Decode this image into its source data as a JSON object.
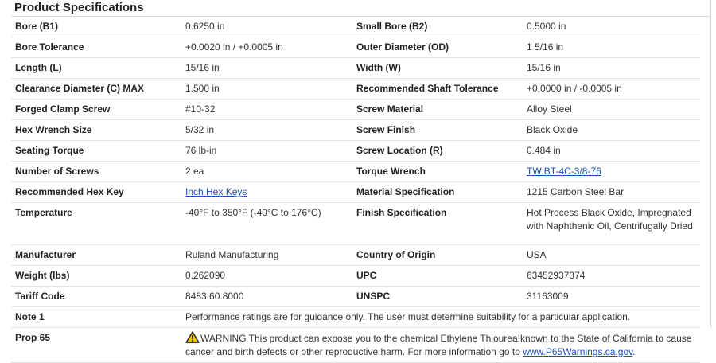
{
  "section_title": "Product Specifications",
  "specs": {
    "bore_b1": {
      "label": "Bore (B1)",
      "value": "0.6250 in"
    },
    "small_bore_b2": {
      "label": "Small Bore (B2)",
      "value": "0.5000 in"
    },
    "bore_tolerance": {
      "label": "Bore Tolerance",
      "value": "+0.0020 in / +0.0005 in"
    },
    "outer_diameter": {
      "label": "Outer Diameter (OD)",
      "value": "1 5/16 in"
    },
    "length": {
      "label": "Length (L)",
      "value": "15/16 in"
    },
    "width": {
      "label": "Width (W)",
      "value": "15/16 in"
    },
    "clearance_diameter": {
      "label": "Clearance Diameter (C) MAX",
      "value": "1.500 in"
    },
    "shaft_tolerance": {
      "label": "Recommended Shaft Tolerance",
      "value": "+0.0000 in / -0.0005 in"
    },
    "clamp_screw": {
      "label": "Forged Clamp Screw",
      "value": "#10-32"
    },
    "screw_material": {
      "label": "Screw Material",
      "value": "Alloy Steel"
    },
    "hex_wrench": {
      "label": "Hex Wrench Size",
      "value": "5/32 in"
    },
    "screw_finish": {
      "label": "Screw Finish",
      "value": "Black Oxide"
    },
    "seating_torque": {
      "label": "Seating Torque",
      "value": "76 lb-in"
    },
    "screw_location": {
      "label": "Screw Location (R)",
      "value": "0.484 in"
    },
    "num_screws": {
      "label": "Number of Screws",
      "value": "2 ea"
    },
    "torque_wrench": {
      "label": "Torque Wrench",
      "value": "TW:BT-4C-3/8-76"
    },
    "hex_key": {
      "label": "Recommended Hex Key",
      "value": "Inch Hex Keys"
    },
    "material_spec": {
      "label": "Material Specification",
      "value": "1215 Carbon Steel Bar"
    },
    "temperature": {
      "label": "Temperature",
      "value": "-40°F to 350°F (-40°C to 176°C)"
    },
    "finish_spec": {
      "label": "Finish Specification",
      "value": "Hot Process Black Oxide, Impregnated with Naphthenic Oil, Centrifugally Dried"
    },
    "manufacturer": {
      "label": "Manufacturer",
      "value": "Ruland Manufacturing"
    },
    "country": {
      "label": "Country of Origin",
      "value": "USA"
    },
    "weight": {
      "label": "Weight (lbs)",
      "value": "0.262090"
    },
    "upc": {
      "label": "UPC",
      "value": "63452937374"
    },
    "tariff": {
      "label": "Tariff Code",
      "value": "8483.60.8000"
    },
    "unspsc": {
      "label": "UNSPC",
      "value": "31163009"
    },
    "note1": {
      "label": "Note 1",
      "value": "Performance ratings are for guidance only. The user must determine suitability for a particular application."
    },
    "prop65": {
      "label": "Prop 65",
      "warning_text": "WARNING This product can expose you to the chemical Ethylene Thiourea!known to the State of California to cause cancer and birth defects or other reproductive harm. For more information go to ",
      "link_text": "www.P65Warnings.ca.gov",
      "trailing": "."
    }
  },
  "colors": {
    "link": "#1a4fb5",
    "warning_icon": "#f2c200"
  },
  "icons": {
    "warning": "warning-triangle-icon"
  }
}
